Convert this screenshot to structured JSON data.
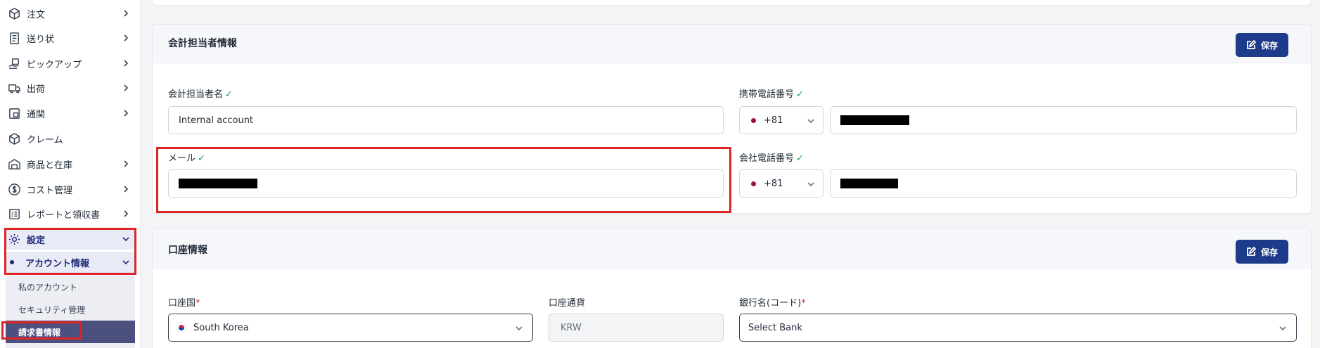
{
  "sidebar": {
    "items": [
      {
        "label": "注文",
        "icon": "box-icon"
      },
      {
        "label": "送り状",
        "icon": "invoice-list-icon"
      },
      {
        "label": "ピックアップ",
        "icon": "pickup-icon"
      },
      {
        "label": "出荷",
        "icon": "truck-icon"
      },
      {
        "label": "通関",
        "icon": "customs-icon"
      },
      {
        "label": "クレーム",
        "icon": "claim-box-icon"
      },
      {
        "label": "商品と在庫",
        "icon": "warehouse-icon"
      },
      {
        "label": "コスト管理",
        "icon": "dollar-icon"
      },
      {
        "label": "レポートと領収書",
        "icon": "report-icon"
      },
      {
        "label": "設定",
        "icon": "gear-icon"
      }
    ],
    "account_group": "アカウント情報",
    "sub_items": [
      "私のアカウント",
      "セキュリティ管理",
      "請求書情報"
    ]
  },
  "accounting_section": {
    "title": "会計担当者情報",
    "save_label": "保存",
    "name_label": "会計担当者名",
    "name_value": "Internal account",
    "mobile_label": "携帯電話番号",
    "mobile_code": "+81",
    "email_label": "メール",
    "company_phone_label": "会社電話番号",
    "company_phone_code": "+81",
    "check_mark": "✓"
  },
  "bank_section": {
    "title": "口座情報",
    "save_label": "保存",
    "country_label": "口座国",
    "country_value": "South Korea",
    "currency_label": "口座通貨",
    "currency_value": "KRW",
    "bank_label": "銀行名(コード)",
    "bank_value": "Select Bank",
    "required_mark": "*"
  },
  "colors": {
    "primary": "#1e3a8a",
    "highlight": "#dc2626",
    "check": "#16a34a"
  }
}
